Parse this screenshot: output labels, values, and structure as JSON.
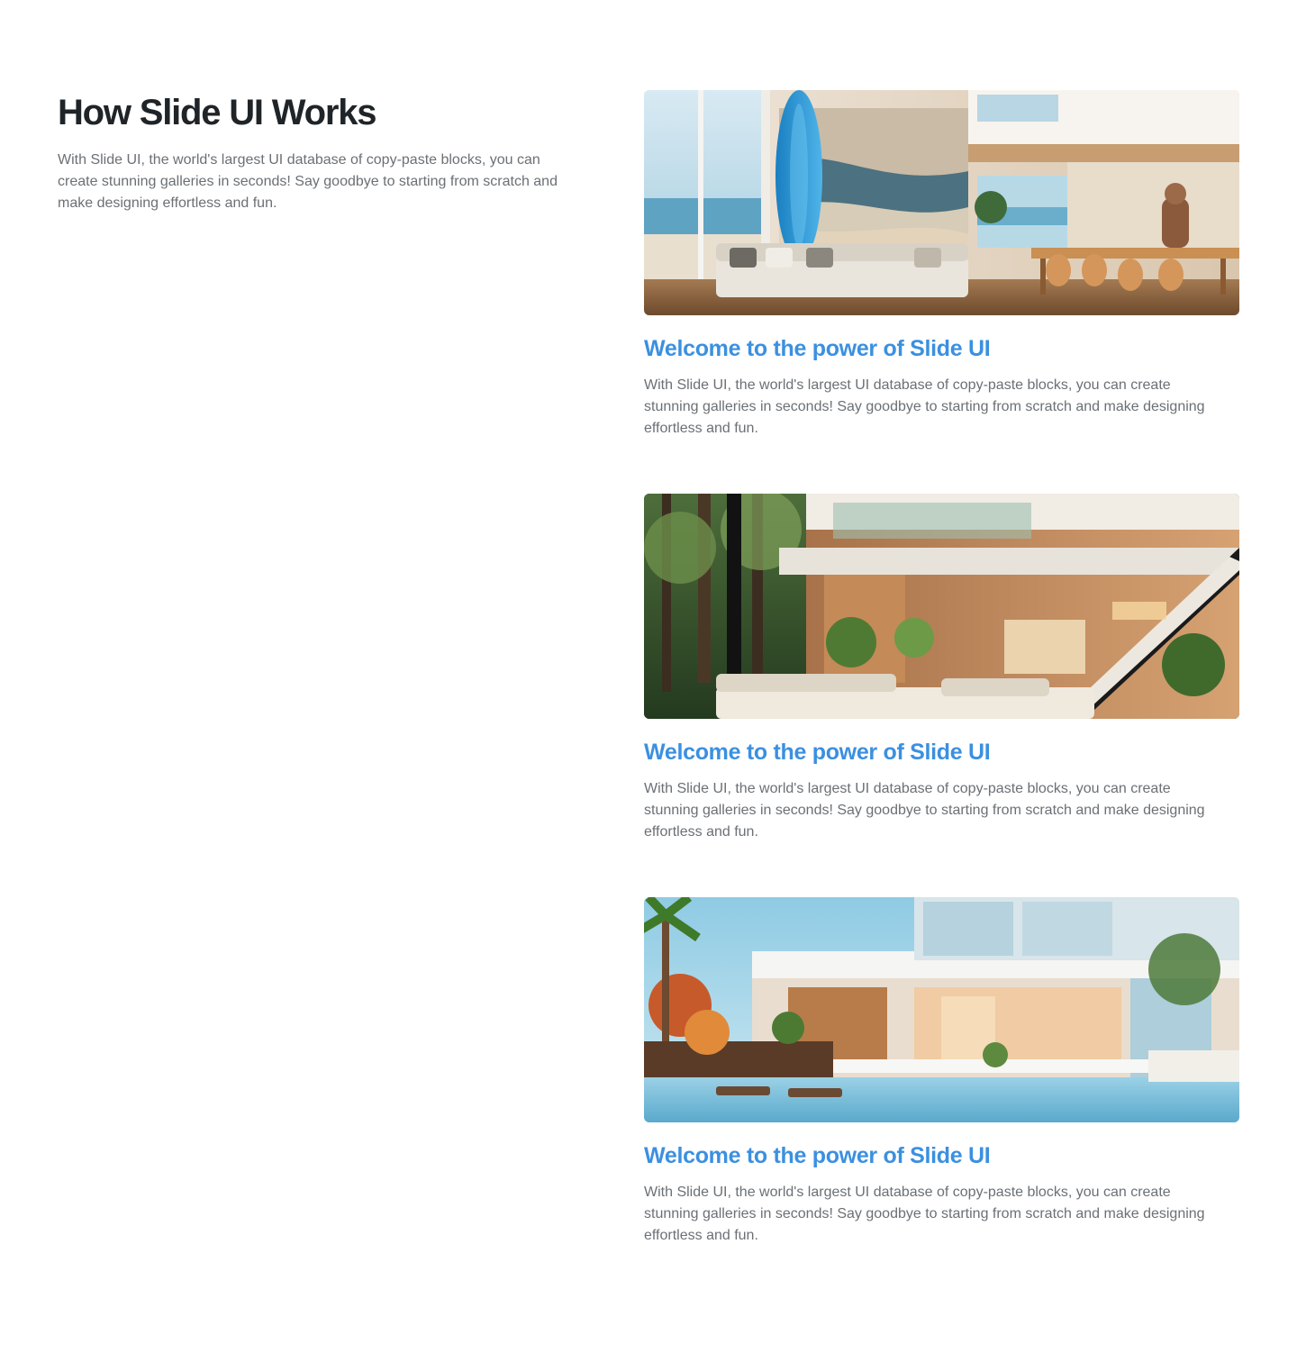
{
  "section": {
    "title": "How Slide UI Works",
    "description": "With Slide UI, the world's largest UI database of copy-paste blocks, you can create stunning galleries in seconds! Say goodbye to starting from scratch and make designing effortless and fun."
  },
  "cards": [
    {
      "image": "beach-house-living-room",
      "title": "Welcome to the power of Slide UI",
      "text": "With Slide UI, the world's largest UI database of copy-paste blocks, you can create stunning galleries in seconds! Say goodbye to starting from scratch and make designing effortless and fun."
    },
    {
      "image": "forest-house-interior",
      "title": "Welcome to the power of Slide UI",
      "text": "With Slide UI, the world's largest UI database of copy-paste blocks, you can create stunning galleries in seconds! Say goodbye to starting from scratch and make designing effortless and fun."
    },
    {
      "image": "modern-villa-with-pool",
      "title": "Welcome to the power of Slide UI",
      "text": "With Slide UI, the world's largest UI database of copy-paste blocks, you can create stunning galleries in seconds! Say goodbye to starting from scratch and make designing effortless and fun."
    }
  ]
}
